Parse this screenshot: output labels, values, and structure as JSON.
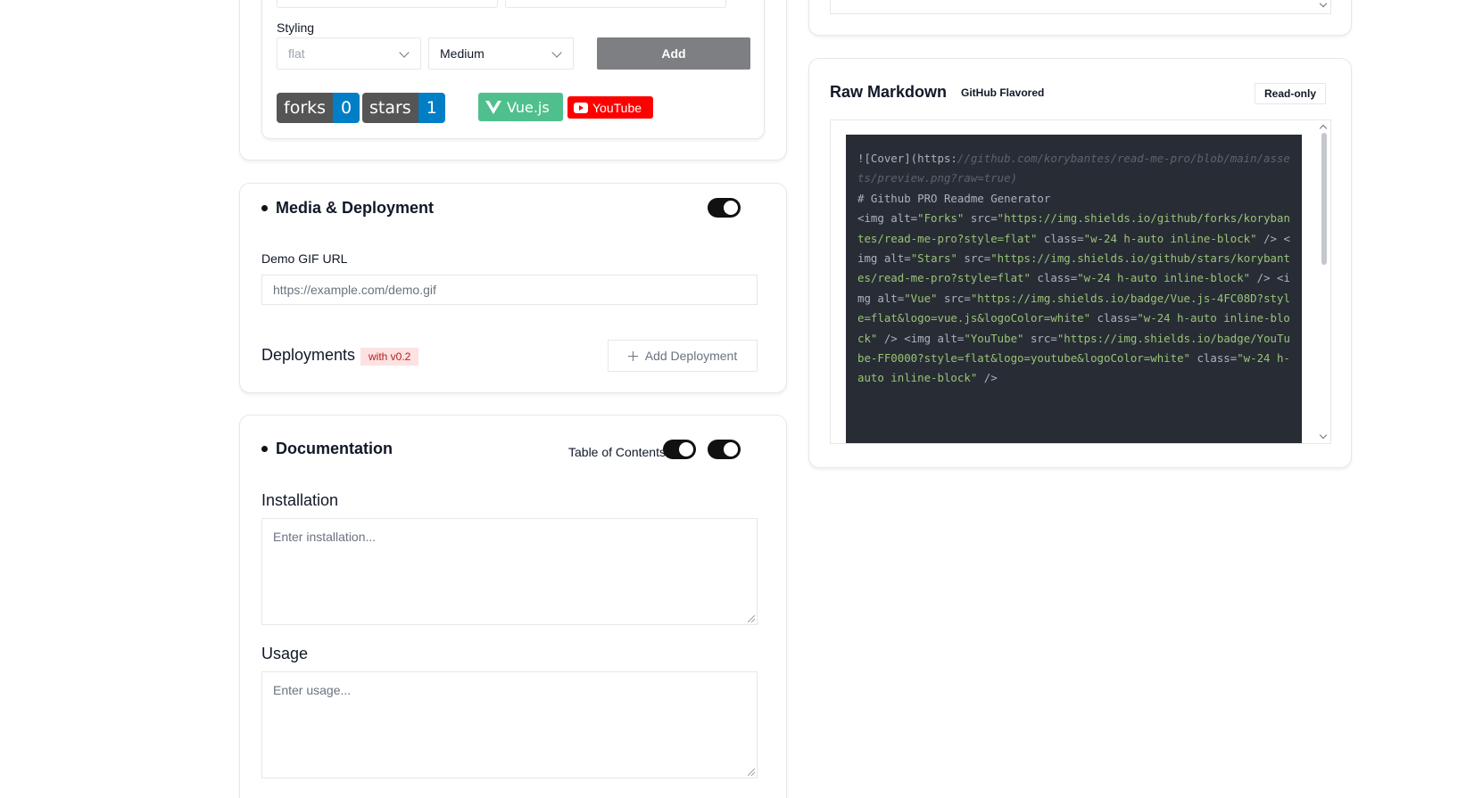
{
  "badges_card": {
    "styling_label": "Styling",
    "style_select": "flat",
    "size_select": "Medium",
    "add_label": "Add",
    "badges": [
      {
        "key": "forks",
        "value": "0"
      },
      {
        "key": "stars",
        "value": "1"
      }
    ],
    "vue_badge": "Vue.js",
    "youtube_badge": "YouTube"
  },
  "media": {
    "title": "Media & Deployment",
    "demo_label": "Demo GIF URL",
    "demo_placeholder": "https://example.com/demo.gif",
    "deployments_label": "Deployments",
    "deployments_tag": "with v0.2",
    "add_deployment": "Add Deployment"
  },
  "docs": {
    "title": "Documentation",
    "toc_label": "Table of Contents",
    "installation_label": "Installation",
    "installation_placeholder": "Enter installation...",
    "usage_label": "Usage",
    "usage_placeholder": "Enter usage..."
  },
  "markdown": {
    "title": "Raw Markdown",
    "flavor": "GitHub Flavored",
    "readonly": "Read-only",
    "code": [
      {
        "t": "![Cover](https:"
      },
      {
        "t": "//github.com/korybantes/read-me-pro/blob/main/assets/preview.png?raw=true)",
        "c": "c"
      },
      {
        "t": "\n# Github PRO Readme Generator\n<img alt="
      },
      {
        "t": "\"Forks\"",
        "c": "s"
      },
      {
        "t": " src="
      },
      {
        "t": "\"https://img.shields.io/github/forks/korybantes/read-me-pro?style=flat\"",
        "c": "s"
      },
      {
        "t": " class="
      },
      {
        "t": "\"w-24 h-auto inline-block\"",
        "c": "s"
      },
      {
        "t": " /> <img alt="
      },
      {
        "t": "\"Stars\"",
        "c": "s"
      },
      {
        "t": " src="
      },
      {
        "t": "\"https://img.shields.io/github/stars/korybantes/read-me-pro?style=flat\"",
        "c": "s"
      },
      {
        "t": " class="
      },
      {
        "t": "\"w-24 h-auto inline-block\"",
        "c": "s"
      },
      {
        "t": " /> <img alt="
      },
      {
        "t": "\"Vue\"",
        "c": "s"
      },
      {
        "t": " src="
      },
      {
        "t": "\"https://img.shields.io/badge/Vue.js-4FC08D?style=flat&logo=vue.js&logoColor=white\"",
        "c": "s"
      },
      {
        "t": " class="
      },
      {
        "t": "\"w-24 h-auto inline-block\"",
        "c": "s"
      },
      {
        "t": " /> <img alt="
      },
      {
        "t": "\"YouTube\"",
        "c": "s"
      },
      {
        "t": " src="
      },
      {
        "t": "\"https://img.shields.io/badge/YouTube-FF0000?style=flat&logo=youtube&logoColor=white\"",
        "c": "s"
      },
      {
        "t": " class="
      },
      {
        "t": "\"w-24 h-auto inline-block\"",
        "c": "s"
      },
      {
        "t": " />"
      }
    ]
  }
}
